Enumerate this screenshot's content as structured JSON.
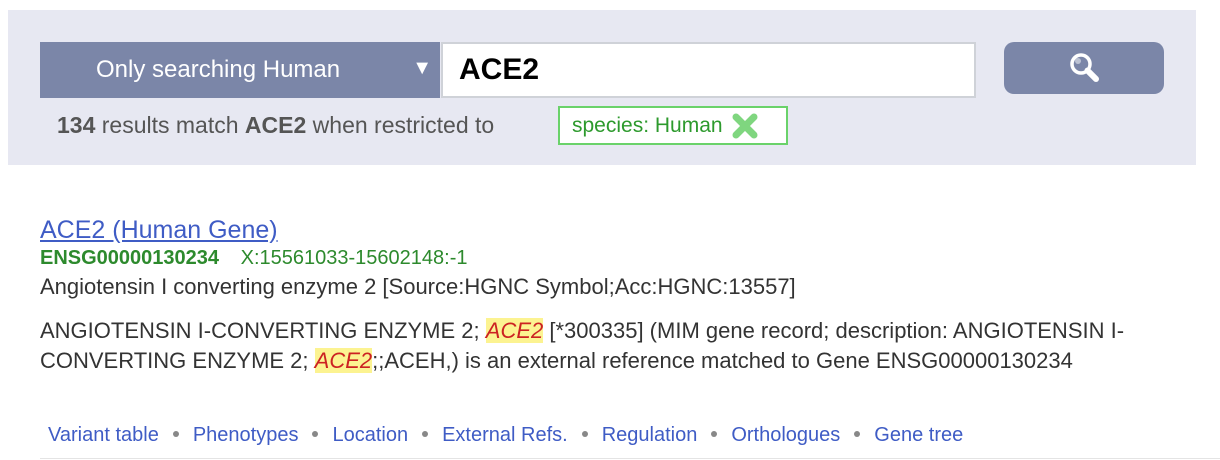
{
  "search": {
    "species_dropdown_label": "Only searching Human",
    "dropdown_arrow": "▼",
    "query_value": "ACE2",
    "search_icon": "magnifier-icon"
  },
  "summary": {
    "count": "134",
    "text_middle": "results match",
    "term": "ACE2",
    "text_end": "when restricted to",
    "filter_label": "species: Human",
    "filter_remove_icon": "green-x-icon"
  },
  "result": {
    "title": "ACE2 (Human Gene)",
    "gene_id": "ENSG00000130234",
    "location": "X:15561033-15602148:-1",
    "description": "Angiotensin I converting enzyme 2 [Source:HGNC Symbol;Acc:HGNC:13557]",
    "mim": {
      "part1": "ANGIOTENSIN I-CONVERTING ENZYME 2; ",
      "highlight1": "ACE2",
      "part2": " [*300335] (MIM gene record; description: ANGIOTENSIN I-CONVERTING ENZYME 2; ",
      "highlight2": "ACE2",
      "part3": ";;ACEH,) is an external reference matched to Gene ENSG00000130234"
    },
    "links": [
      "Variant table",
      "Phenotypes",
      "Location",
      "External Refs.",
      "Regulation",
      "Orthologues",
      "Gene tree"
    ]
  },
  "colors": {
    "panel_bg": "#e7e8f2",
    "accent_button": "#7b86a8",
    "link": "#3f5cc5",
    "gene_green": "#2d8a2d",
    "highlight_bg": "#fcf391",
    "highlight_text": "#cc2222"
  }
}
